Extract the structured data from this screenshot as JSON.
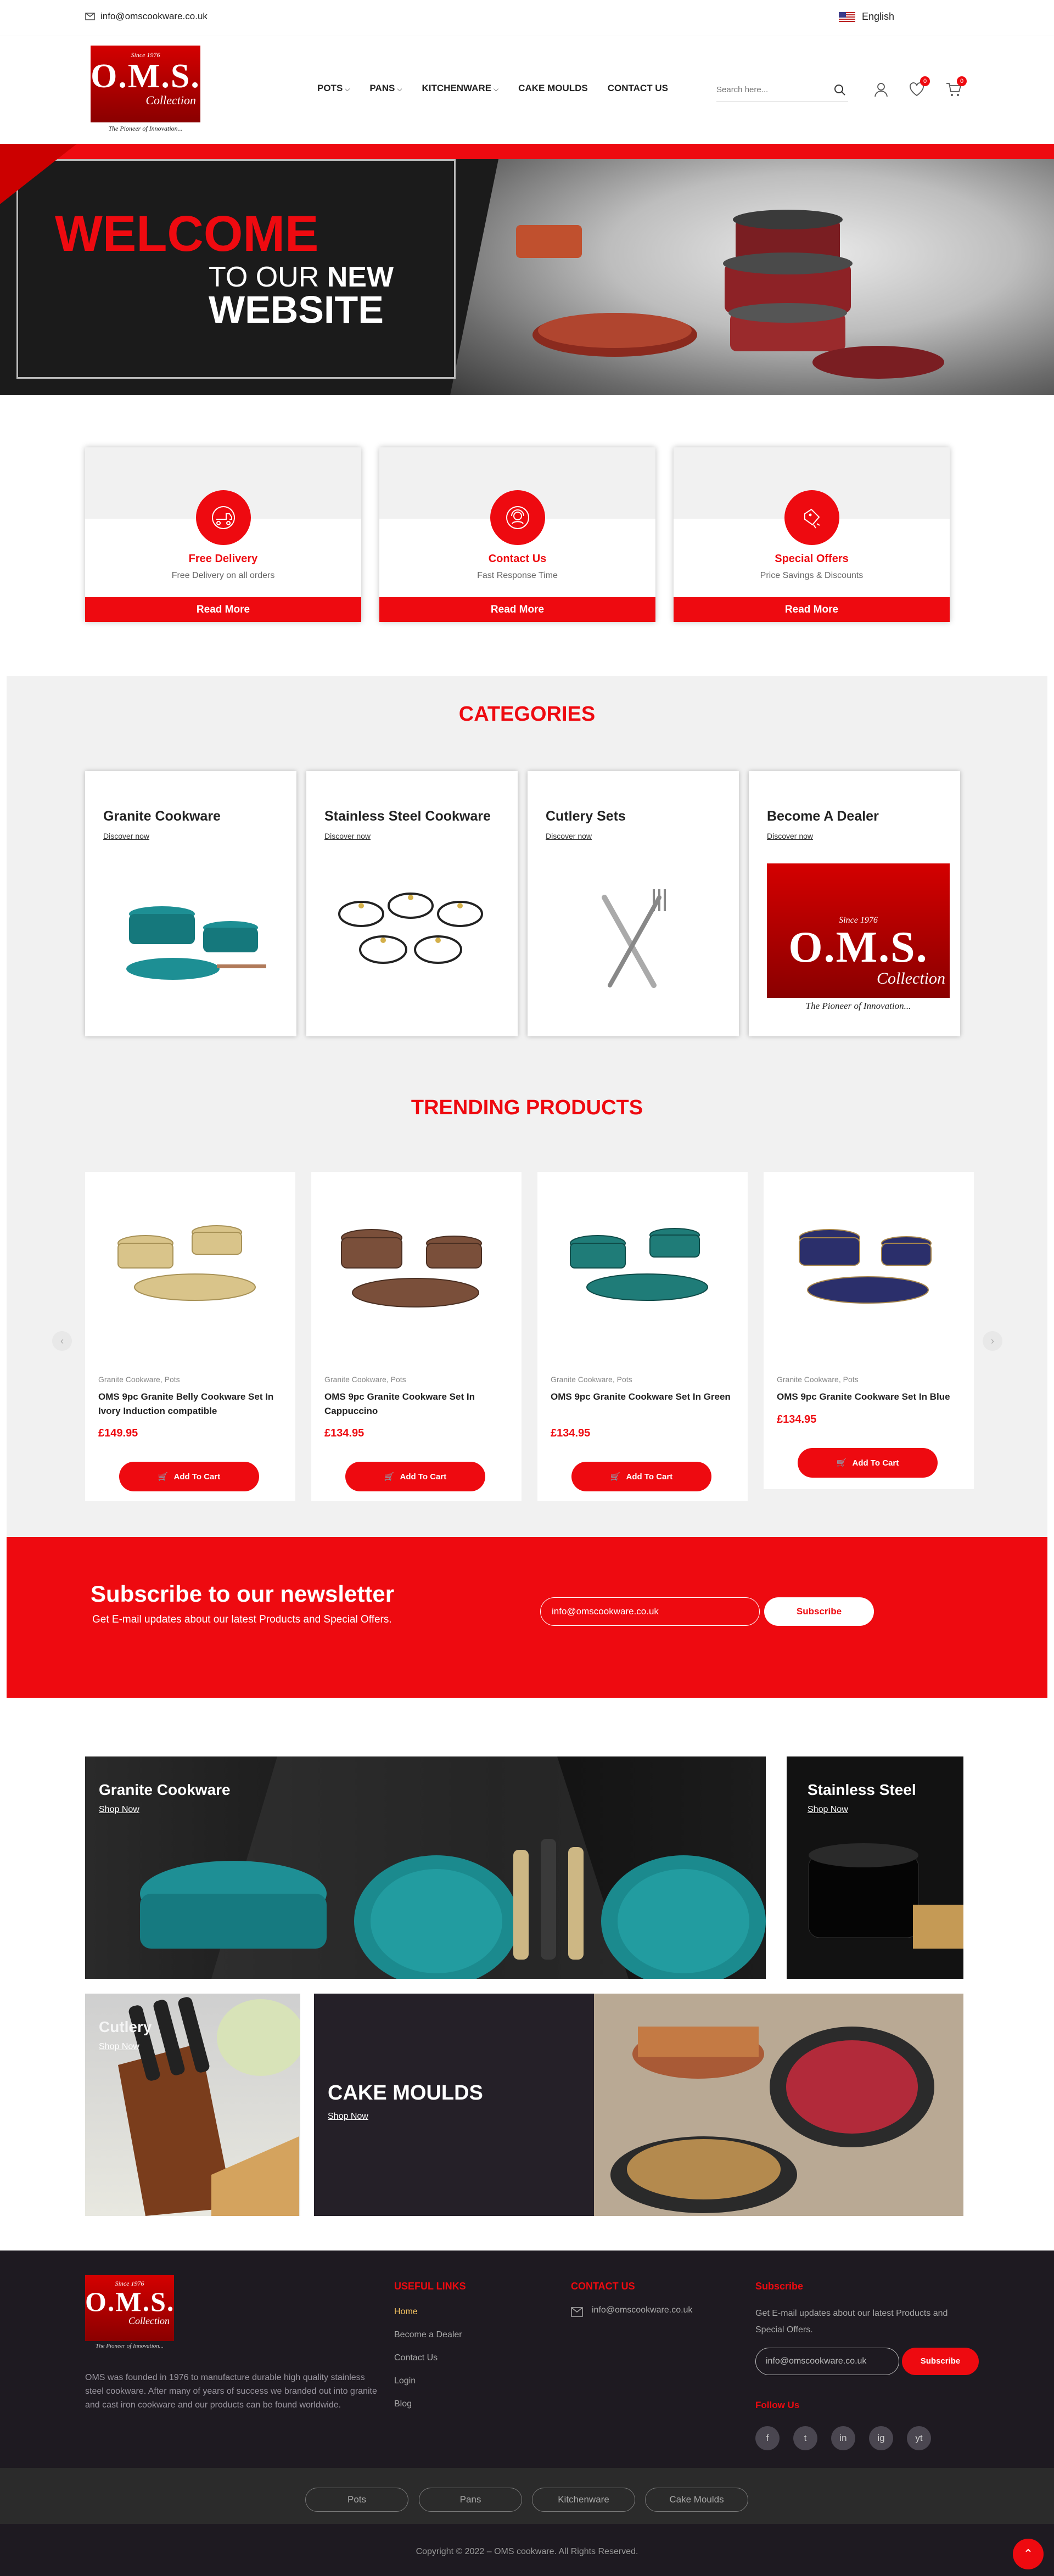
{
  "colors": {
    "accent": "#ee0a10",
    "footer_bg": "#1e1a21"
  },
  "topbar": {
    "email": "info@omscookware.co.uk",
    "language": "English"
  },
  "logo": {
    "since": "Since 1976",
    "brand": "O.M.S.",
    "collection": "Collection",
    "tagline": "The Pioneer of Innovation..."
  },
  "nav": [
    {
      "label": "POTS"
    },
    {
      "label": "PANS"
    },
    {
      "label": "KITCHENWARE"
    },
    {
      "label": "CAKE MOULDS"
    },
    {
      "label": "CONTACT US"
    }
  ],
  "search": {
    "placeholder": "Search here..."
  },
  "header": {
    "wishlist_count": "0",
    "cart_count": "0"
  },
  "hero": {
    "welcome": "WELCOME",
    "to_our": "TO OUR",
    "new": "NEW",
    "website": "WEBSITE"
  },
  "features": [
    {
      "title": "Free Delivery",
      "subtitle": "Free Delivery on all orders",
      "button": "Read More",
      "icon": "delivery-icon"
    },
    {
      "title": "Contact Us",
      "subtitle": "Fast Response Time",
      "button": "Read More",
      "icon": "support-icon"
    },
    {
      "title": "Special Offers",
      "subtitle": "Price Savings & Discounts",
      "button": "Read More",
      "icon": "offer-icon"
    }
  ],
  "categories": {
    "title": "CATEGORIES",
    "items": [
      {
        "title": "Granite Cookware",
        "link": "Discover now"
      },
      {
        "title": "Stainless Steel Cookware",
        "link": "Discover now"
      },
      {
        "title": "Cutlery Sets",
        "link": "Discover now"
      },
      {
        "title": "Become A Dealer",
        "link": "Discover now"
      }
    ]
  },
  "trending": {
    "title": "TRENDING PRODUCTS",
    "products": [
      {
        "category": "Granite Cookware, Pots",
        "name": "OMS 9pc Granite Belly Cookware Set In Ivory Induction compatible",
        "price": "£149.95",
        "button": "Add To Cart",
        "color": "#d9c48a"
      },
      {
        "category": "Granite Cookware, Pots",
        "name": "OMS 9pc Granite Cookware Set In Cappuccino",
        "price": "£134.95",
        "button": "Add To Cart",
        "color": "#7a4f3a"
      },
      {
        "category": "Granite Cookware, Pots",
        "name": "OMS 9pc Granite Cookware Set In Green",
        "price": "£134.95",
        "button": "Add To Cart",
        "color": "#1f7c78"
      },
      {
        "category": "Granite Cookware, Pots",
        "name": "OMS 9pc Granite Cookware Set In Blue",
        "price": "£134.95",
        "button": "Add To Cart",
        "color": "#2b2f6b"
      }
    ]
  },
  "newsletter": {
    "title": "Subscribe to our newsletter",
    "subtitle": "Get E-mail updates about our latest Products and Special Offers.",
    "email_value": "info@omscookware.co.uk",
    "button": "Subscribe"
  },
  "banners": [
    {
      "title": "Granite Cookware",
      "link": "Shop Now"
    },
    {
      "title": "Stainless Steel",
      "link": "Shop Now"
    },
    {
      "title": "Cutlery",
      "link": "Shop Now"
    },
    {
      "title": "CAKE MOULDS",
      "link": "Shop Now"
    }
  ],
  "footer": {
    "about": "OMS was founded in 1976 to manufacture durable high quality stainless steel cookware. After many of years of success we branded out into granite and cast iron cookware and our products can be found worldwide.",
    "useful_links_title": "USEFUL LINKS",
    "useful_links": [
      "Home",
      "Become a Dealer",
      "Contact Us",
      "Login",
      "Blog"
    ],
    "contact_title": "CONTACT US",
    "contact_email": "info@omscookware.co.uk",
    "subscribe_title": "Subscribe",
    "subscribe_text": "Get E-mail updates about our latest Products and Special Offers.",
    "subscribe_value": "info@omscookware.co.uk",
    "subscribe_button": "Subscribe",
    "follow_title": "Follow Us",
    "socials": [
      "f",
      "t",
      "in",
      "ig",
      "yt"
    ],
    "bottom_links": [
      "Pots",
      "Pans",
      "Kitchenware",
      "Cake Moulds"
    ],
    "copyright": "Copyright © 2022 – OMS cookware. All Rights Reserved."
  }
}
